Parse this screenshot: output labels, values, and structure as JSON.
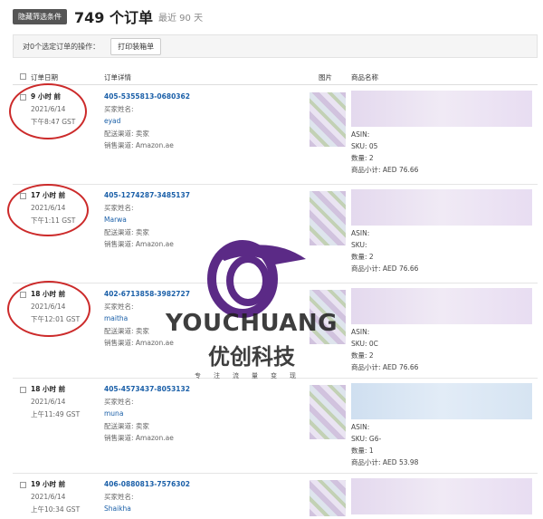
{
  "header": {
    "filter_button": "隐藏筛选条件",
    "count_label": "749 个订单",
    "range_label": "最近 90 天"
  },
  "actions": {
    "label": "对0个选定订单的操作：",
    "print_button": "打印装箱单"
  },
  "columns": {
    "date": "订单日期",
    "details": "订单详情",
    "image": "图片",
    "name": "商品名称"
  },
  "orders": [
    {
      "ago": "9 小时 前",
      "date": "2021/6/14",
      "time": "下午8:47 GST",
      "order_id": "405-5355813-0680362",
      "buyer_label": "买家姓名:",
      "buyer": "eyad",
      "fulfillment": "配送渠道: 卖家",
      "channel": "销售渠道: Amazon.ae",
      "asin": "ASIN:",
      "sku": "SKU: 05",
      "qty": "数量: 2",
      "subtotal": "商品小计: AED 76.66"
    },
    {
      "ago": "17 小时 前",
      "date": "2021/6/14",
      "time": "下午1:11 GST",
      "order_id": "405-1274287-3485137",
      "buyer_label": "买家姓名:",
      "buyer": "Marwa",
      "fulfillment": "配送渠道: 卖家",
      "channel": "销售渠道: Amazon.ae",
      "asin": "ASIN:",
      "sku": "SKU:",
      "qty": "数量: 2",
      "subtotal": "商品小计: AED 76.66"
    },
    {
      "ago": "18 小时 前",
      "date": "2021/6/14",
      "time": "下午12:01 GST",
      "order_id": "402-6713858-3982727",
      "buyer_label": "买家姓名:",
      "buyer": "maitha",
      "fulfillment": "配送渠道: 卖家",
      "channel": "销售渠道: Amazon.ae",
      "asin": "ASIN:",
      "sku": "SKU: 0C",
      "qty": "数量: 2",
      "subtotal": "商品小计: AED 76.66"
    },
    {
      "ago": "18 小时 前",
      "date": "2021/6/14",
      "time": "上午11:49 GST",
      "order_id": "405-4573437-8053132",
      "buyer_label": "买家姓名:",
      "buyer": "muna",
      "fulfillment": "配送渠道: 卖家",
      "channel": "销售渠道: Amazon.ae",
      "asin": "ASIN:",
      "sku": "SKU: G6-",
      "qty": "数量: 1",
      "subtotal": "商品小计: AED 53.98"
    },
    {
      "ago": "19 小时 前",
      "date": "2021/6/14",
      "time": "上午10:34 GST",
      "order_id": "406-0880813-7576302",
      "buyer_label": "买家姓名:",
      "buyer": "Shaikha",
      "fulfillment": "",
      "channel": "",
      "asin": "",
      "sku": "",
      "qty": "",
      "subtotal": ""
    }
  ],
  "watermark": {
    "brand": "YOUCHUANG",
    "brand_cn": "优创科技",
    "tagline": "专注流量变现"
  },
  "colors": {
    "link": "#1a5fa8",
    "annotation": "#cc2a2a",
    "logo": "#5b2a86"
  }
}
